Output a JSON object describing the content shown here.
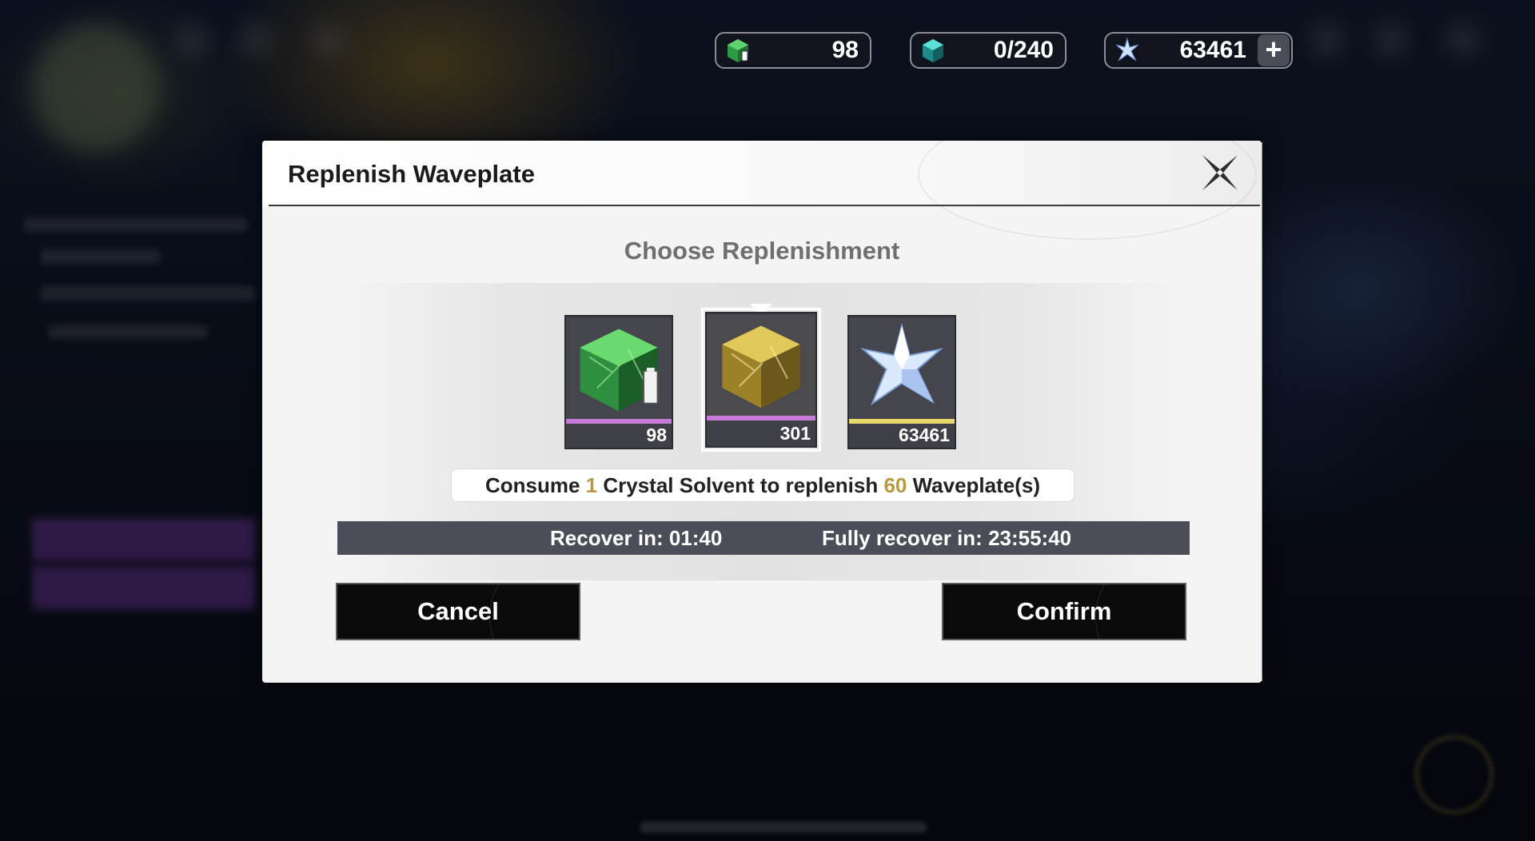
{
  "currency_bar": {
    "items": [
      {
        "icon": "crystal-solvent-icon",
        "value": "98"
      },
      {
        "icon": "waveplate-icon",
        "value": "0/240"
      },
      {
        "icon": "astrite-icon",
        "value": "63461"
      }
    ],
    "add_label": "+"
  },
  "dialog": {
    "title": "Replenish Waveplate",
    "subtitle": "Choose Replenishment",
    "items": [
      {
        "name": "crystal-solvent-battery",
        "count": "98",
        "rarity_color": "#c77ad6"
      },
      {
        "name": "crystal-solvent",
        "count": "301",
        "rarity_color": "#c77ad6",
        "selected": true
      },
      {
        "name": "astrite",
        "count": "63461",
        "rarity_color": "#e8d86a"
      }
    ],
    "consume": {
      "prefix": "Consume ",
      "amount": "1",
      "middle": " Crystal Solvent to replenish ",
      "result": "60",
      "suffix": " Waveplate(s)"
    },
    "recover": {
      "next": "Recover in:  01:40",
      "full": "Fully recover in:  23:55:40"
    },
    "cancel_label": "Cancel",
    "confirm_label": "Confirm"
  },
  "colors": {
    "highlight": "#b99a3e",
    "recover_bar": "#4b4e58",
    "button_bg": "#0a0a0a"
  }
}
